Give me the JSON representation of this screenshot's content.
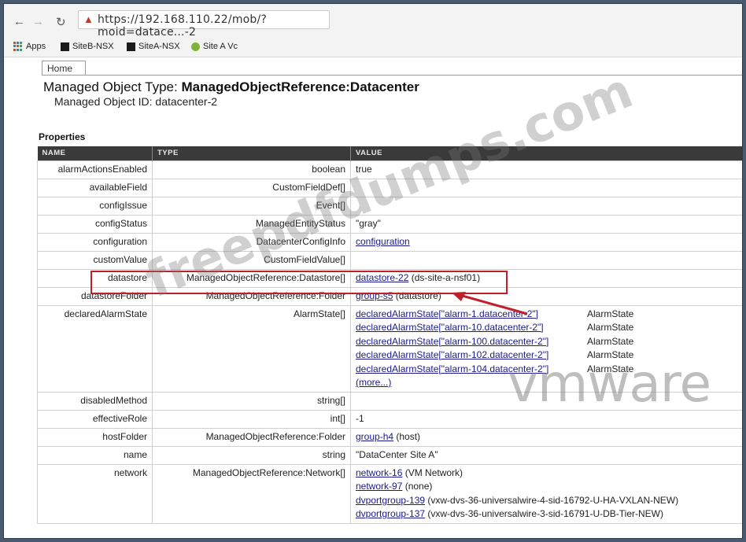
{
  "browser": {
    "url": "https://192.168.110.22/mob/?moid=datace...-2",
    "bookmarks": [
      "Apps",
      "SiteB-NSX",
      "SiteA-NSX",
      "Site A Vc"
    ]
  },
  "page": {
    "home_tab": "Home",
    "object_type_label": "Managed Object Type:",
    "object_type_value": "ManagedObjectReference:Datacenter",
    "object_id_label": "Managed Object ID:",
    "object_id_value": "datacenter-2",
    "properties_label": "Properties",
    "columns": [
      "NAME",
      "TYPE",
      "VALUE"
    ]
  },
  "properties": [
    {
      "name": "alarmActionsEnabled",
      "type": "boolean",
      "value": "true"
    },
    {
      "name": "availableField",
      "type": "CustomFieldDef[]",
      "value": ""
    },
    {
      "name": "configIssue",
      "type": "Event[]",
      "value": ""
    },
    {
      "name": "configStatus",
      "type": "ManagedEntityStatus",
      "value": "\"gray\""
    },
    {
      "name": "configuration",
      "type": "DatacenterConfigInfo",
      "value_link": "configuration"
    },
    {
      "name": "customValue",
      "type": "CustomFieldValue[]",
      "value": ""
    },
    {
      "name": "datastore",
      "type": "ManagedObjectReference:Datastore[]",
      "value_link": "datastore-22",
      "value_suffix": " (ds-site-a-nsf01)"
    },
    {
      "name": "datastoreFolder",
      "type": "ManagedObjectReference:Folder",
      "value_link": "group-s5",
      "value_suffix": " (datastore)"
    },
    {
      "name": "disabledMethod",
      "type": "string[]",
      "value": ""
    },
    {
      "name": "effectiveRole",
      "type": "int[]",
      "value": "-1"
    },
    {
      "name": "hostFolder",
      "type": "ManagedObjectReference:Folder",
      "value_link": "group-h4",
      "value_suffix": " (host)"
    },
    {
      "name": "name",
      "type": "string",
      "value": "\"DataCenter Site A\""
    }
  ],
  "declared_alarm_state": {
    "name": "declaredAlarmState",
    "type": "AlarmState[]",
    "items": [
      {
        "link": "declaredAlarmState[\"alarm-1.datacenter-2\"]",
        "type": "AlarmState"
      },
      {
        "link": "declaredAlarmState[\"alarm-10.datacenter-2\"]",
        "type": "AlarmState"
      },
      {
        "link": "declaredAlarmState[\"alarm-100.datacenter-2\"]",
        "type": "AlarmState"
      },
      {
        "link": "declaredAlarmState[\"alarm-102.datacenter-2\"]",
        "type": "AlarmState"
      },
      {
        "link": "declaredAlarmState[\"alarm-104.datacenter-2\"]",
        "type": "AlarmState"
      }
    ],
    "more": "(more...)"
  },
  "network": {
    "name": "network",
    "type": "ManagedObjectReference:Network[]",
    "items": [
      {
        "link": "network-16",
        "suffix": " (VM Network)"
      },
      {
        "link": "network-97",
        "suffix": " (none)"
      },
      {
        "link": "dvportgroup-139",
        "suffix": " (vxw-dvs-36-universalwire-4-sid-16792-U-HA-VXLAN-NEW)"
      },
      {
        "link": "dvportgroup-137",
        "suffix": " (vxw-dvs-36-universalwire-3-sid-16791-U-DB-Tier-NEW)"
      }
    ]
  },
  "watermarks": {
    "site": "freepdfdumps.com",
    "brand": "vmware"
  },
  "colors": {
    "highlight": "#c0202a",
    "header_bg": "#3a3a3a",
    "link": "#1a1a8a"
  }
}
